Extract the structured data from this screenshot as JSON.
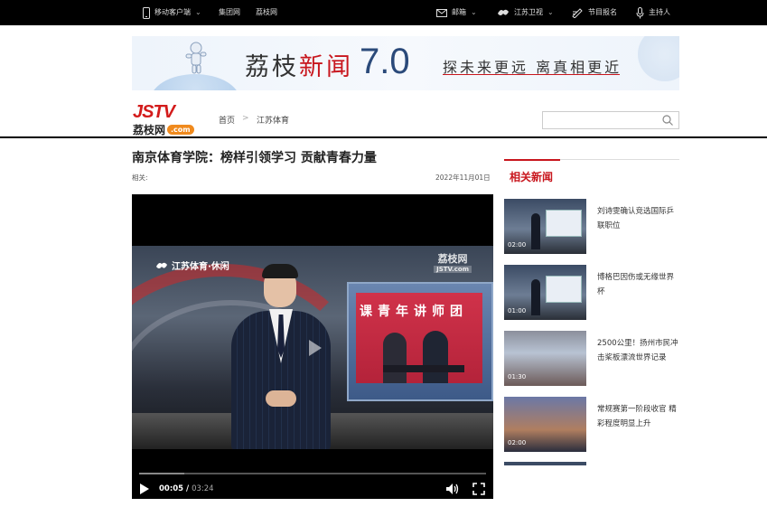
{
  "topbar": {
    "mobile": "移动客户端",
    "group": "集团网",
    "lizhi": "荔枝网",
    "mail": "邮箱",
    "satellite": "江苏卫视",
    "signup": "节目报名",
    "host": "主持人"
  },
  "banner": {
    "title_a": "荔枝",
    "title_b": "新闻",
    "version": "7.0",
    "slogan": "探未来更远  离真相更近"
  },
  "logo": {
    "top": "JSTV",
    "cn": "荔枝网",
    "com": ".com"
  },
  "breadcrumb": [
    "首页",
    "江苏体育"
  ],
  "search": {
    "placeholder": ""
  },
  "article": {
    "title": "南京体育学院：榜样引领学习 贡献青春力量",
    "related_label": "相关:",
    "date": "2022年11月01日"
  },
  "video": {
    "channel": "江苏体育·休闲",
    "wm_top": "荔枝网",
    "wm_bottom": "JSTV.com",
    "screen_text": "课青年讲师团",
    "current_time": "00:05",
    "separator": " / ",
    "duration": "03:24",
    "progress_fraction": 0.02,
    "buffered_fraction": 0.13
  },
  "sidebar": {
    "heading": "相关新闻",
    "items": [
      {
        "title": "刘诗雯确认竞选国际乒联职位",
        "time": "02:00"
      },
      {
        "title": "博格巴因伤或无缘世界杯",
        "time": "01:00"
      },
      {
        "title": "2500公里！扬州市民冲击桨板漂流世界记录",
        "time": "01:30"
      },
      {
        "title": "常规赛第一阶段收官 精彩程度明显上升",
        "time": "02:00"
      }
    ]
  },
  "colors": {
    "accent": "#c8161d",
    "topbar": "#000000",
    "logo_orange": "#f08a1d"
  }
}
